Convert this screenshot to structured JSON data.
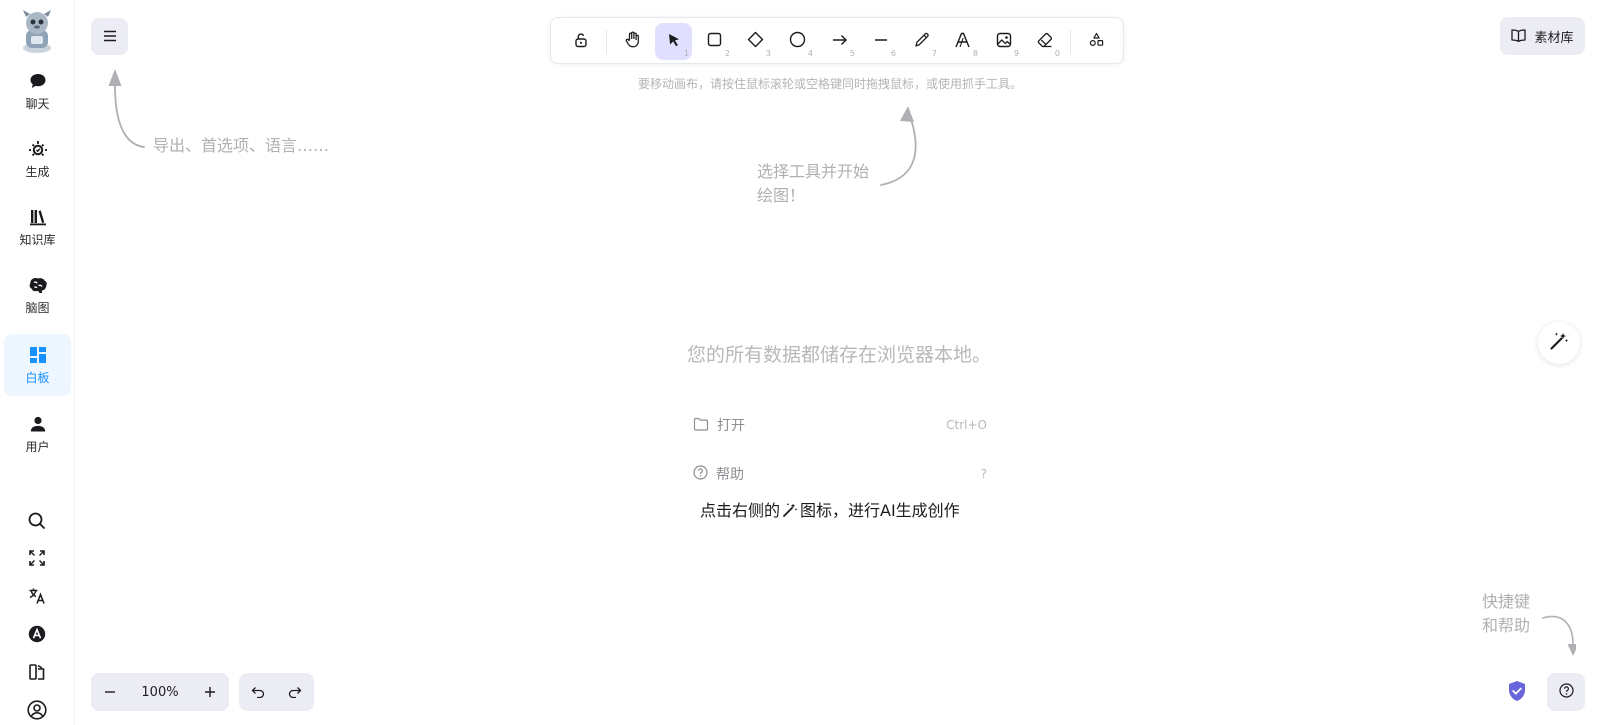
{
  "sidebar": {
    "logo": "robot-avatar-logo",
    "items": [
      {
        "label": "聊天",
        "icon": "chat-bubble-icon",
        "active": false
      },
      {
        "label": "生成",
        "icon": "sparkle-sun-icon",
        "active": false
      },
      {
        "label": "知识库",
        "icon": "books-icon",
        "active": false
      },
      {
        "label": "脑图",
        "icon": "brain-icon",
        "active": false
      },
      {
        "label": "白板",
        "icon": "dashboard-grid-icon",
        "active": true
      },
      {
        "label": "用户",
        "icon": "person-icon",
        "active": false
      }
    ],
    "utilities": [
      "search-icon",
      "fullscreen-icon",
      "translate-icon",
      "a-circle-icon",
      "apps-icon",
      "account-circle-icon"
    ]
  },
  "toolbar": {
    "tools": [
      {
        "name": "lock",
        "icon": "lock-icon",
        "key": ""
      },
      {
        "name": "hand",
        "icon": "hand-icon",
        "key": ""
      },
      {
        "name": "selection",
        "icon": "pointer-icon",
        "key": "1",
        "active": true
      },
      {
        "name": "rectangle",
        "icon": "rectangle-icon",
        "key": "2"
      },
      {
        "name": "diamond",
        "icon": "diamond-icon",
        "key": "3"
      },
      {
        "name": "ellipse",
        "icon": "ellipse-icon",
        "key": "4"
      },
      {
        "name": "arrow",
        "icon": "arrow-icon",
        "key": "5"
      },
      {
        "name": "line",
        "icon": "line-icon",
        "key": "6"
      },
      {
        "name": "draw",
        "icon": "pencil-icon",
        "key": "7"
      },
      {
        "name": "text",
        "icon": "text-icon",
        "key": "8"
      },
      {
        "name": "image",
        "icon": "image-icon",
        "key": "9"
      },
      {
        "name": "eraser",
        "icon": "eraser-icon",
        "key": "0"
      },
      {
        "name": "more-shapes",
        "icon": "shapes-icon",
        "key": ""
      }
    ]
  },
  "library": {
    "label": "素材库"
  },
  "hints": {
    "canvas_move": "要移动画布，请按住鼠标滚轮或空格键同时拖拽鼠标，或使用抓手工具。",
    "menu": "导出、首选项、语言……",
    "tool_line1": "选择工具并开始",
    "tool_line2": "绘图！",
    "help_line1": "快捷键",
    "help_line2": "和帮助"
  },
  "welcome": {
    "title": "您的所有数据都储存在浏览器本地。",
    "open_label": "打开",
    "open_shortcut": "Ctrl+O",
    "help_label": "帮助",
    "help_shortcut": "?"
  },
  "ai_hint": {
    "before": "点击右侧的",
    "after": "图标，进行AI生成创作"
  },
  "zoom": {
    "value": "100%"
  },
  "colors": {
    "accent": "#1890ff",
    "tool_active": "#e0dfff",
    "shield": "#6965db"
  }
}
